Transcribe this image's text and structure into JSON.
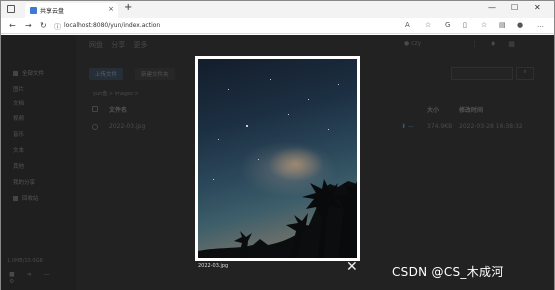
{
  "browser": {
    "tab_title": "共享云盘",
    "tab_close": "×",
    "new_tab": "+",
    "url": "localhost:8080/yun/index.action",
    "win_min": "—",
    "win_max": "☐",
    "win_close": "✕"
  },
  "sidebar": {
    "items": [
      "全部文件",
      "图片",
      "文档",
      "视频",
      "音乐",
      "文本",
      "其他",
      "我的分享",
      "回收站"
    ],
    "storage": "1.0MB/10.0GB"
  },
  "header": {
    "nav": [
      "网盘",
      "分享",
      "更多"
    ],
    "user": "czy"
  },
  "toolbar": {
    "upload_label": "上传文件",
    "new_folder_label": "新建文件夹",
    "search_icon": "search-icon"
  },
  "breadcrumb": "yun盘 > images >",
  "table": {
    "headers": {
      "name": "文件名",
      "size": "大小",
      "date": "修改时间"
    },
    "rows": [
      {
        "name": "2022-03.jpg",
        "size": "374.9KB",
        "date": "2022-03-28 16:38:32"
      }
    ]
  },
  "viewer": {
    "caption": "2022-03.jpg",
    "close": "✕"
  },
  "watermark": "CSDN @CS_木成河"
}
